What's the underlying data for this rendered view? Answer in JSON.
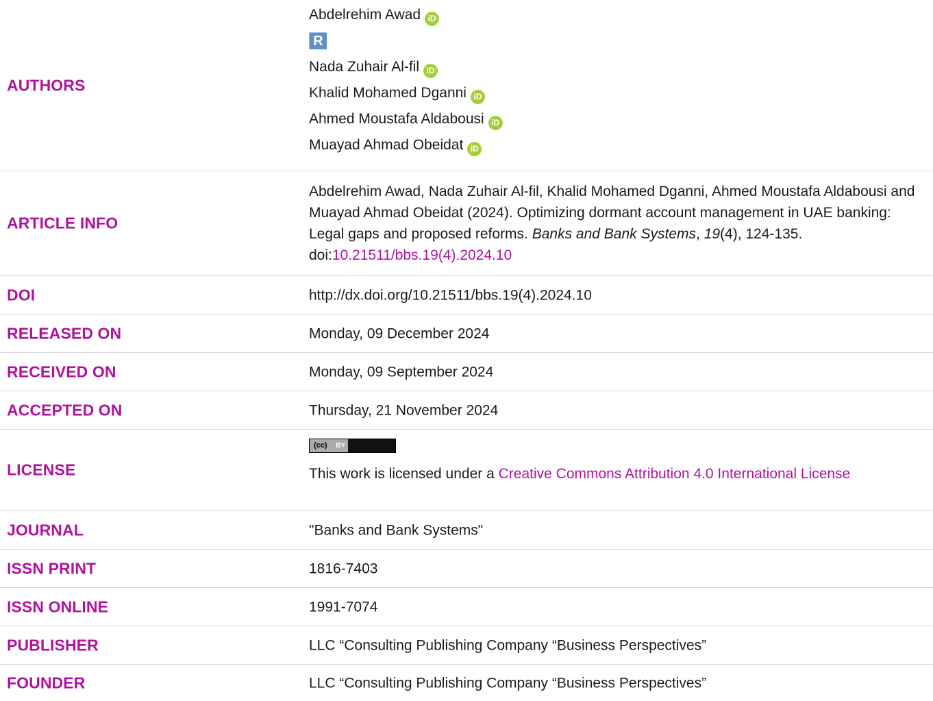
{
  "authors": {
    "label": "AUTHORS",
    "names": [
      "Abdelrehim Awad",
      "Nada Zuhair Al-fil",
      "Khalid Mohamed Dganni",
      "Ahmed Moustafa Aldabousi",
      "Muayad Ahmad Obeidat"
    ],
    "orcid_icon": "iD",
    "researcher_icon": "R"
  },
  "article_info": {
    "label": "ARTICLE INFO",
    "citation_prefix": "Abdelrehim Awad, Nada Zuhair Al-fil, Khalid Mohamed Dganni, Ahmed Moustafa Aldabousi and Muayad Ahmad Obeidat (2024). Optimizing dormant account management in UAE banking: Legal gaps and proposed reforms. ",
    "journal_italic": "Banks and Bank Systems",
    "comma1": ", ",
    "volume_italic": "19",
    "issue_pages": "(4), 124-135. doi:",
    "doi_link": "10.21511/bbs.19(4).2024.10"
  },
  "doi": {
    "label": "DOI",
    "value": "http://dx.doi.org/10.21511/bbs.19(4).2024.10"
  },
  "released_on": {
    "label": "RELEASED ON",
    "value": "Monday, 09 December 2024"
  },
  "received_on": {
    "label": "RECEIVED ON",
    "value": "Monday, 09 September 2024"
  },
  "accepted_on": {
    "label": "ACCEPTED ON",
    "value": "Thursday, 21 November 2024"
  },
  "license": {
    "label": "LICENSE",
    "badge_cc": "(cc)",
    "badge_by": "BY",
    "text_prefix": "This work is licensed under a ",
    "link_text": "Creative Commons Attribution 4.0 International License"
  },
  "journal": {
    "label": "JOURNAL",
    "value": "\"Banks and Bank Systems\""
  },
  "issn_print": {
    "label": "ISSN PRINT",
    "value": "1816-7403"
  },
  "issn_online": {
    "label": "ISSN ONLINE",
    "value": "1991-7074"
  },
  "publisher": {
    "label": "PUBLISHER",
    "value": "LLC “Consulting Publishing Company “Business Perspectives”"
  },
  "founder": {
    "label": "FOUNDER",
    "value": "LLC “Consulting Publishing Company “Business Perspectives”"
  },
  "colors": {
    "label": "#b0129e",
    "orcid": "#a6ce39",
    "researcher": "#5f90c7",
    "divider": "#d7d7d7"
  }
}
